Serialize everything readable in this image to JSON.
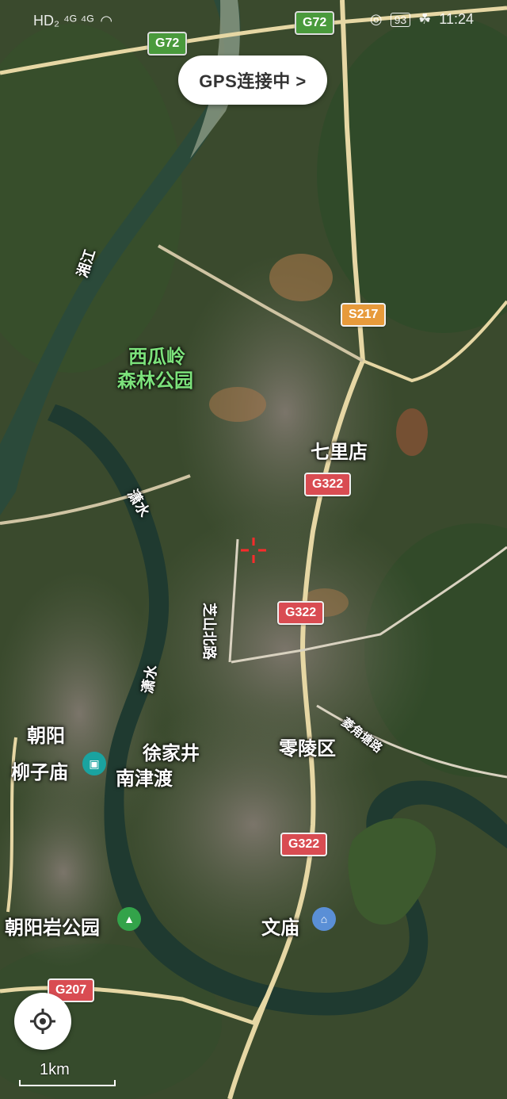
{
  "status_bar": {
    "left_indicators": "HD₂ ⁴ᴳ ⁴ᴳ",
    "battery": "93",
    "time": "11:24"
  },
  "gps_pill": {
    "label": "GPS连接中 >"
  },
  "route_shields": [
    {
      "id": "g72-left",
      "text": "G72",
      "style": "g"
    },
    {
      "id": "g72-top",
      "text": "G72",
      "style": "g"
    },
    {
      "id": "s217",
      "text": "S217",
      "style": "o"
    },
    {
      "id": "g322-1",
      "text": "G322",
      "style": "r"
    },
    {
      "id": "g322-2",
      "text": "G322",
      "style": "r"
    },
    {
      "id": "g322-3",
      "text": "G322",
      "style": "r"
    },
    {
      "id": "g207",
      "text": "G207",
      "style": "r"
    }
  ],
  "place_labels": {
    "xiangjiang": "湘江",
    "xiguaying": "西瓜岭",
    "senlin_park": "森林公园",
    "qilidian": "七里店",
    "xiaoshui_1": "潇水",
    "xiaoshui_2": "潇水",
    "zhishan_road": "芝山北路",
    "chaoyang": "朝阳",
    "liuzimiao": "柳子庙",
    "xujiajing": "徐家井",
    "nanjindu": "南津渡",
    "lingling": "零陵区",
    "lingjiao_road": "菱角塘路",
    "chaoyangyan_park": "朝阳岩公园",
    "wenmiao": "文庙"
  },
  "scale": {
    "label": "1km"
  },
  "icons": [
    "location-pin-icon",
    "leaf-icon",
    "camera-poi-icon",
    "tree-poi-icon",
    "landmark-poi-icon",
    "locate-icon",
    "crosshair-icon"
  ],
  "colors": {
    "river": "#1f3b2e",
    "land": "#3b4a2f",
    "urban": "#6f6a5c",
    "highway": "#e9d9a6",
    "poi_teal": "#1aa3a0",
    "poi_green": "#33a34a",
    "poi_blue": "#5a8fd6"
  }
}
